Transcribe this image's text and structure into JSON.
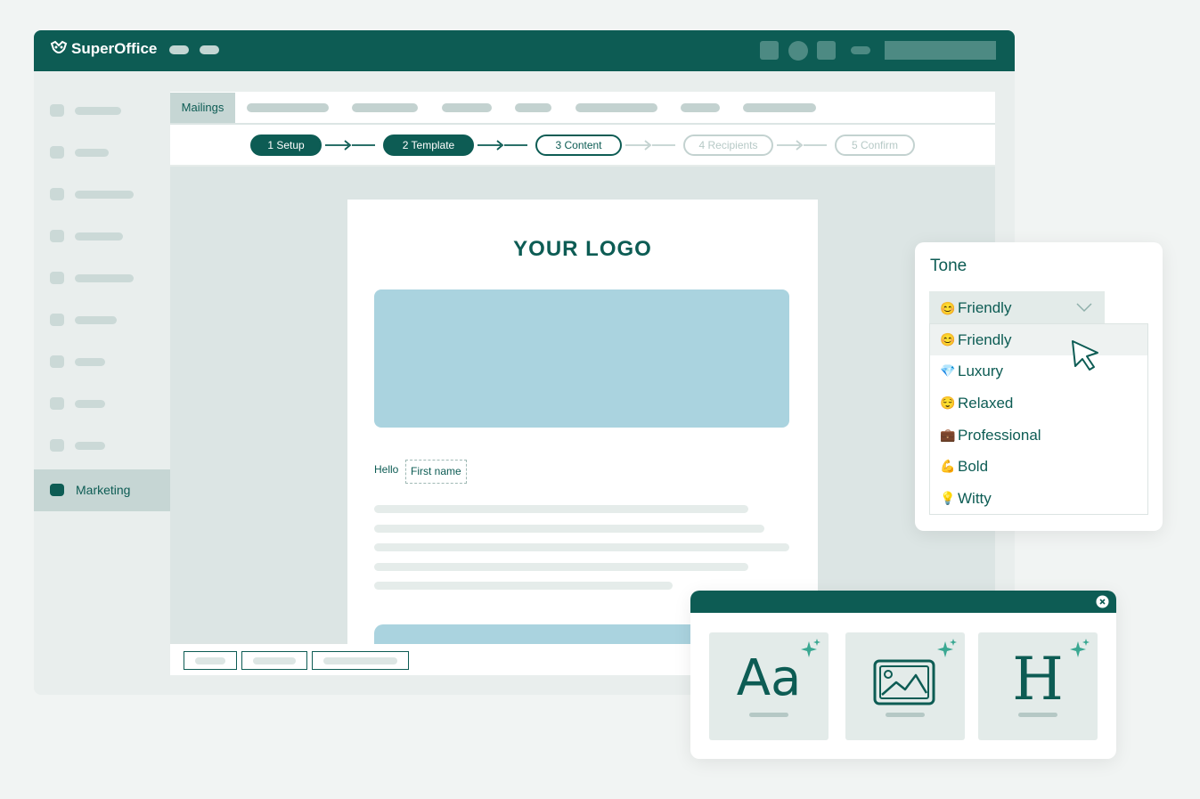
{
  "app": {
    "brand": "SuperOffice"
  },
  "sidebar": {
    "active_label": "Marketing"
  },
  "tabs": {
    "active": "Mailings"
  },
  "steps": [
    {
      "label": "1 Setup",
      "state": "done"
    },
    {
      "label": "2 Template",
      "state": "done"
    },
    {
      "label": "3 Content",
      "state": "current"
    },
    {
      "label": "4 Recipients",
      "state": "future"
    },
    {
      "label": "5 Confirm",
      "state": "future"
    }
  ],
  "email": {
    "logo": "YOUR LOGO",
    "greeting": "Hello",
    "merge_field": "First name"
  },
  "tone": {
    "title": "Tone",
    "selected": {
      "emoji": "😊",
      "label": "Friendly"
    },
    "options": [
      {
        "emoji": "😊",
        "label": "Friendly"
      },
      {
        "emoji": "💎",
        "label": "Luxury"
      },
      {
        "emoji": "😌",
        "label": "Relaxed"
      },
      {
        "emoji": "💼",
        "label": "Professional"
      },
      {
        "emoji": "💪",
        "label": "Bold"
      },
      {
        "emoji": "💡",
        "label": "Witty"
      }
    ]
  },
  "tools": {
    "text_glyph": "Aa",
    "heading_glyph": "H"
  },
  "colors": {
    "brand": "#0d5c54",
    "accent": "#aad3df",
    "sparkle": "#3aa892"
  }
}
